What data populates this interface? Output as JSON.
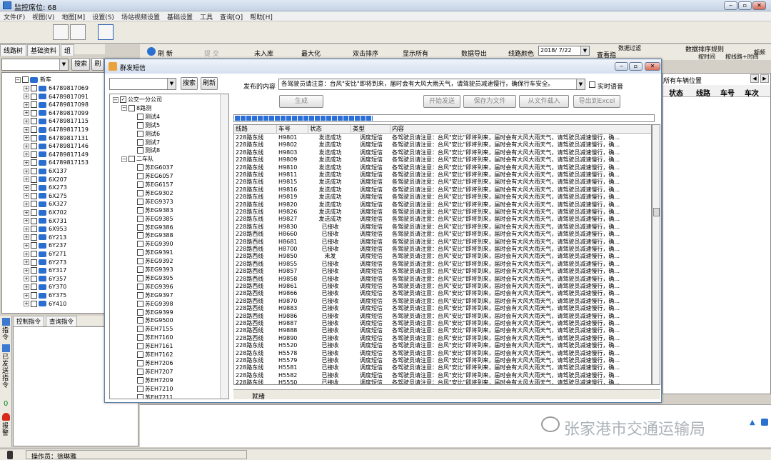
{
  "app": {
    "title": "监控席位: 68"
  },
  "menu": [
    "文件(F)",
    "视图(V)",
    "地图[M]",
    "设置(S)",
    "场站视频设置",
    "基础设置",
    "工具",
    "查询[Q]",
    "帮助[H]"
  ],
  "left_tabs": [
    "线路树",
    "基础资料",
    "组"
  ],
  "left_panel": {
    "search": "搜索",
    "refresh": "刷"
  },
  "vehicle_tree": {
    "root": "新车",
    "items": [
      "64789817069",
      "64789817091",
      "64789817098",
      "64789817099",
      "64789817115",
      "64789817119",
      "64789817131",
      "64789817146",
      "64789817149",
      "64789817153",
      "6X137",
      "6X207",
      "6X273",
      "6X275",
      "6X327",
      "6X702",
      "6X731",
      "6X953",
      "6Y213",
      "6Y237",
      "6Y271",
      "6Y273",
      "6Y317",
      "6Y357",
      "6Y370",
      "6Y375",
      "6Y410"
    ]
  },
  "cmd_tabs": [
    "控制指令",
    "查询指令"
  ],
  "side_labels": {
    "cmd": "指令",
    "sent": "已发送指令",
    "count": "0",
    "alarm": "报警"
  },
  "main_toolbar": {
    "refresh": "刷 新",
    "submit": "提 交",
    "enter": "未入库",
    "maximize": "最大化",
    "dblclick_sort": "双击排序",
    "show_all": "显示所有",
    "export": "数据导出",
    "line_color": "线路颜色",
    "date": "2018/ 7/22",
    "view": "查看指",
    "filter": "数据过滤",
    "sort_rule": "数据排序规则",
    "by_time": "按时间",
    "by_line": "按线路+时间",
    "freq": "额频"
  },
  "right_table": {
    "title": "所有车辆位置",
    "headers": [
      "状态",
      "线路",
      "车号",
      "车次"
    ]
  },
  "dialog": {
    "title": "群发短信",
    "search": "搜索",
    "refresh": "刷新",
    "content_label": "发布的内容",
    "content_value": "各驾驶员请注意：台风\"安比\"即将到来，届时会有大风大雨天气，请驾驶员减速慢行，确保行车安全。",
    "realtime_voice": "实时语音",
    "generate": "生成",
    "start_send": "开始发送",
    "save_file": "保存为文件",
    "load_file": "从文件载入",
    "export_excel": "导出到Excel",
    "progress": 0.33,
    "status": "就绪",
    "tree": [
      {
        "label": "公交一分公司",
        "checked": true,
        "expand": "⊟",
        "indent": 0
      },
      {
        "label": "8路测",
        "checked": false,
        "expand": "⊟",
        "indent": 1
      },
      {
        "label": "测试4",
        "checked": false,
        "expand": "",
        "indent": 2
      },
      {
        "label": "测试5",
        "checked": false,
        "expand": "",
        "indent": 2
      },
      {
        "label": "测试6",
        "checked": false,
        "expand": "",
        "indent": 2
      },
      {
        "label": "测试7",
        "checked": false,
        "expand": "",
        "indent": 2
      },
      {
        "label": "测试8",
        "checked": false,
        "expand": "",
        "indent": 2
      },
      {
        "label": "二车队",
        "checked": false,
        "expand": "⊟",
        "indent": 1
      },
      {
        "label": "苏EG6037",
        "checked": false,
        "expand": "",
        "indent": 2
      },
      {
        "label": "苏EG6057",
        "checked": false,
        "expand": "",
        "indent": 2
      },
      {
        "label": "苏EG6157",
        "checked": false,
        "expand": "",
        "indent": 2
      },
      {
        "label": "苏EG9302",
        "checked": false,
        "expand": "",
        "indent": 2
      },
      {
        "label": "苏EG9373",
        "checked": false,
        "expand": "",
        "indent": 2
      },
      {
        "label": "苏EG9383",
        "checked": false,
        "expand": "",
        "indent": 2
      },
      {
        "label": "苏EG9385",
        "checked": false,
        "expand": "",
        "indent": 2
      },
      {
        "label": "苏EG9386",
        "checked": false,
        "expand": "",
        "indent": 2
      },
      {
        "label": "苏EG9388",
        "checked": false,
        "expand": "",
        "indent": 2
      },
      {
        "label": "苏EG9390",
        "checked": false,
        "expand": "",
        "indent": 2
      },
      {
        "label": "苏EG9391",
        "checked": false,
        "expand": "",
        "indent": 2
      },
      {
        "label": "苏EG9392",
        "checked": false,
        "expand": "",
        "indent": 2
      },
      {
        "label": "苏EG9393",
        "checked": false,
        "expand": "",
        "indent": 2
      },
      {
        "label": "苏EG9395",
        "checked": false,
        "expand": "",
        "indent": 2
      },
      {
        "label": "苏EG9396",
        "checked": false,
        "expand": "",
        "indent": 2
      },
      {
        "label": "苏EG9397",
        "checked": false,
        "expand": "",
        "indent": 2
      },
      {
        "label": "苏EG9398",
        "checked": false,
        "expand": "",
        "indent": 2
      },
      {
        "label": "苏EG9399",
        "checked": false,
        "expand": "",
        "indent": 2
      },
      {
        "label": "苏EG9500",
        "checked": false,
        "expand": "",
        "indent": 2
      },
      {
        "label": "苏EH7155",
        "checked": false,
        "expand": "",
        "indent": 2
      },
      {
        "label": "苏EH7160",
        "checked": false,
        "expand": "",
        "indent": 2
      },
      {
        "label": "苏EH7161",
        "checked": false,
        "expand": "",
        "indent": 2
      },
      {
        "label": "苏EH7162",
        "checked": false,
        "expand": "",
        "indent": 2
      },
      {
        "label": "苏EH7206",
        "checked": false,
        "expand": "",
        "indent": 2
      },
      {
        "label": "苏EH7207",
        "checked": false,
        "expand": "",
        "indent": 2
      },
      {
        "label": "苏EH7209",
        "checked": false,
        "expand": "",
        "indent": 2
      },
      {
        "label": "苏EH7210",
        "checked": false,
        "expand": "",
        "indent": 2
      },
      {
        "label": "苏EH7211",
        "checked": false,
        "expand": "",
        "indent": 2
      }
    ],
    "grid_headers": [
      "线路",
      "车号",
      "状态",
      "类型",
      "内容"
    ],
    "msg": "各驾驶员请注意：台风\"安比\"即将到来，届时会有大风大雨天气，请驾驶员减速慢行，确...",
    "rows": [
      [
        "228路东线",
        "H9801",
        "发送成功",
        "调度短信"
      ],
      [
        "228路东线",
        "H9802",
        "发送成功",
        "调度短信"
      ],
      [
        "228路东线",
        "H9803",
        "发送成功",
        "调度短信"
      ],
      [
        "228路东线",
        "H9809",
        "发送成功",
        "调度短信"
      ],
      [
        "228路东线",
        "H9810",
        "发送成功",
        "调度短信"
      ],
      [
        "228路东线",
        "H9811",
        "发送成功",
        "调度短信"
      ],
      [
        "228路东线",
        "H9815",
        "发送成功",
        "调度短信"
      ],
      [
        "228路东线",
        "H9816",
        "发送成功",
        "调度短信"
      ],
      [
        "228路东线",
        "H9819",
        "发送成功",
        "调度短信"
      ],
      [
        "228路东线",
        "H9820",
        "发送成功",
        "调度短信"
      ],
      [
        "228路东线",
        "H9826",
        "发送成功",
        "调度短信"
      ],
      [
        "228路东线",
        "H9827",
        "发送成功",
        "调度短信"
      ],
      [
        "228路东线",
        "H9830",
        "已接收",
        "调度短信"
      ],
      [
        "228路西线",
        "H8660",
        "已接收",
        "调度短信"
      ],
      [
        "228路西线",
        "H8681",
        "已接收",
        "调度短信"
      ],
      [
        "228路西线",
        "H8700",
        "已接收",
        "调度短信"
      ],
      [
        "228路西线",
        "H9850",
        "未发",
        "调度短信"
      ],
      [
        "228路西线",
        "H9855",
        "已接收",
        "调度短信"
      ],
      [
        "228路西线",
        "H9857",
        "已接收",
        "调度短信"
      ],
      [
        "228路西线",
        "H9858",
        "已接收",
        "调度短信"
      ],
      [
        "228路西线",
        "H9861",
        "已接收",
        "调度短信"
      ],
      [
        "228路西线",
        "H9866",
        "已接收",
        "调度短信"
      ],
      [
        "228路西线",
        "H9870",
        "已接收",
        "调度短信"
      ],
      [
        "228路西线",
        "H9883",
        "已接收",
        "调度短信"
      ],
      [
        "228路西线",
        "H9886",
        "已接收",
        "调度短信"
      ],
      [
        "228路西线",
        "H9887",
        "已接收",
        "调度短信"
      ],
      [
        "228路西线",
        "H9888",
        "已接收",
        "调度短信"
      ],
      [
        "228路西线",
        "H9890",
        "已接收",
        "调度短信"
      ],
      [
        "228路东线",
        "H5520",
        "已接收",
        "调度短信"
      ],
      [
        "228路东线",
        "H5578",
        "已接收",
        "调度短信"
      ],
      [
        "228路东线",
        "H5579",
        "已接收",
        "调度短信"
      ],
      [
        "228路东线",
        "H5581",
        "已接收",
        "调度短信"
      ],
      [
        "228路东线",
        "H5582",
        "已接收",
        "调度短信"
      ],
      [
        "228路东线",
        "H5550",
        "已接收",
        "调度短信"
      ]
    ]
  },
  "watermark": "张家港市交通运输局",
  "statusbar": {
    "operator": "操作员：徐琳雅"
  }
}
